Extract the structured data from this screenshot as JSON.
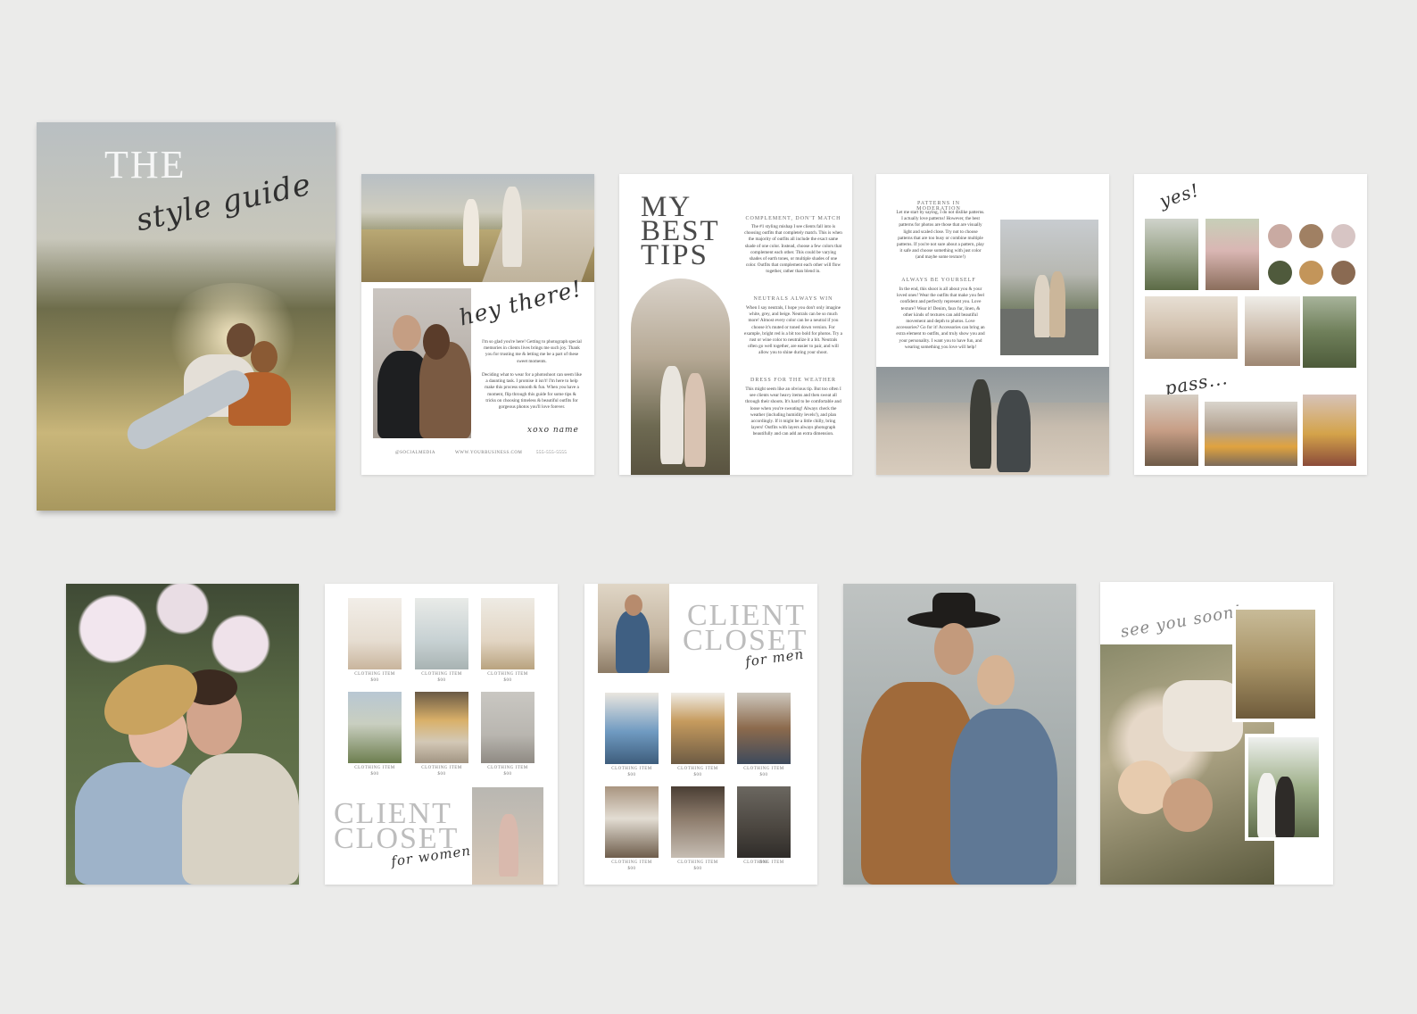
{
  "cover": {
    "title_the": "THE",
    "title_script": "style guide"
  },
  "page_hey": {
    "heading": "hey there!",
    "para1": "I'm so glad you're here! Getting to photograph special memories in clients lives brings me such joy. Thank you for trusting me & letting me be a part of these sweet moments.",
    "para2": "Deciding what to wear for a photoshoot can seem like a daunting task. I promise it isn't! I'm here to help make this process smooth & fun. When you have a moment, flip through this guide for some tips & tricks on choosing timeless & beautiful outfits for gorgeous photos you'll love forever.",
    "signature": "xoxo name",
    "footer_social": "@SOCIALMEDIA",
    "footer_web": "WWW.YOURBUSINESS.COM",
    "footer_phone": "555-555-5555"
  },
  "page_tips": {
    "title": "MY BEST TIPS",
    "h1": "COMPLEMENT, DON'T MATCH",
    "p1": "The #1 styling mishap I see clients fall into is choosing outfits that completely match. This is when the majority of outfits all include the exact same shade of one color. Instead, choose a few colors that complement each other. This could be varying shades of earth tones, or multiple shades of one color. Outfits that complement each other will flow together, rather than blend in.",
    "h2": "NEUTRALS ALWAYS WIN",
    "p2": "When I say neutrals, I hope you don't only imagine white, grey, and beige. Neutrals can be so much more! Almost every color can be a neutral if you choose it's muted or toned down version. For example, bright red is a bit too bold for photos. Try a rust or wine color to neutralize it a bit. Neutrals often go well together, are easier to pair, and will allow you to shine during your shoot.",
    "h3": "DRESS FOR THE WEATHER",
    "p3": "This might seem like an obvious tip. But too often I see clients wear heavy items and then sweat all through their shoots. It's hard to be comfortable and loose when you're sweating! Always check the weather (including humidity levels!), and plan accordingly. If it might be a little chilly, bring layers! Outfits with layers always photograph beautifully and can add an extra dimension."
  },
  "page_patterns": {
    "h1": "PATTERNS IN MODERATION",
    "p1": "Let me start by saying, I do not dislike patterns. I actually love patterns! However, the best patterns for photos are those that are visually light and scaled close. Try not to choose patterns that are too busy or combine multiple patterns. If you're not sure about a pattern, play it safe and choose something with just color (and maybe some texture!)",
    "h2": "ALWAYS BE YOURSELF",
    "p2": "In the end, this shoot is all about you & your loved ones! Wear the outfits that make you feel confident and perfectly represent you. Love texture? Wear it! Denim, faux fur, linen, & other kinds of textures can add beautiful movement and depth to photos. Love accessories? Go for it! Accessories can bring an extra element to outfits, and truly show you and your personality. I want you to have fun, and wearing something you love will help!"
  },
  "page_yes": {
    "yes_label": "yes!",
    "pass_label": "pass...",
    "swatches": [
      "#c9aaa2",
      "#a08063",
      "#d7c5c4",
      "#4f5a3c",
      "#c3955a",
      "#8a6a52"
    ]
  },
  "page_women": {
    "title_line1": "CLIENT",
    "title_line2": "CLOSET",
    "subtitle": "for women",
    "items": [
      {
        "label": "CLOTHING ITEM",
        "price": "$00"
      },
      {
        "label": "CLOTHING ITEM",
        "price": "$00"
      },
      {
        "label": "CLOTHING ITEM",
        "price": "$00"
      },
      {
        "label": "CLOTHING ITEM",
        "price": "$00"
      },
      {
        "label": "CLOTHING ITEM",
        "price": "$00"
      },
      {
        "label": "CLOTHING ITEM",
        "price": "$00"
      }
    ]
  },
  "page_men": {
    "title_line1": "CLIENT",
    "title_line2": "CLOSET",
    "subtitle": "for men",
    "items": [
      {
        "label": "CLOTHING ITEM",
        "price": "$00"
      },
      {
        "label": "CLOTHING ITEM",
        "price": "$00"
      },
      {
        "label": "CLOTHING ITEM",
        "price": "$00"
      },
      {
        "label": "CLOTHING ITEM",
        "price": "$00"
      },
      {
        "label": "CLOTHING ITEM",
        "price": "$00"
      },
      {
        "label": "CLOTHING ITEM",
        "price": "$00"
      }
    ]
  },
  "page_end": {
    "heading": "see you soon!"
  }
}
